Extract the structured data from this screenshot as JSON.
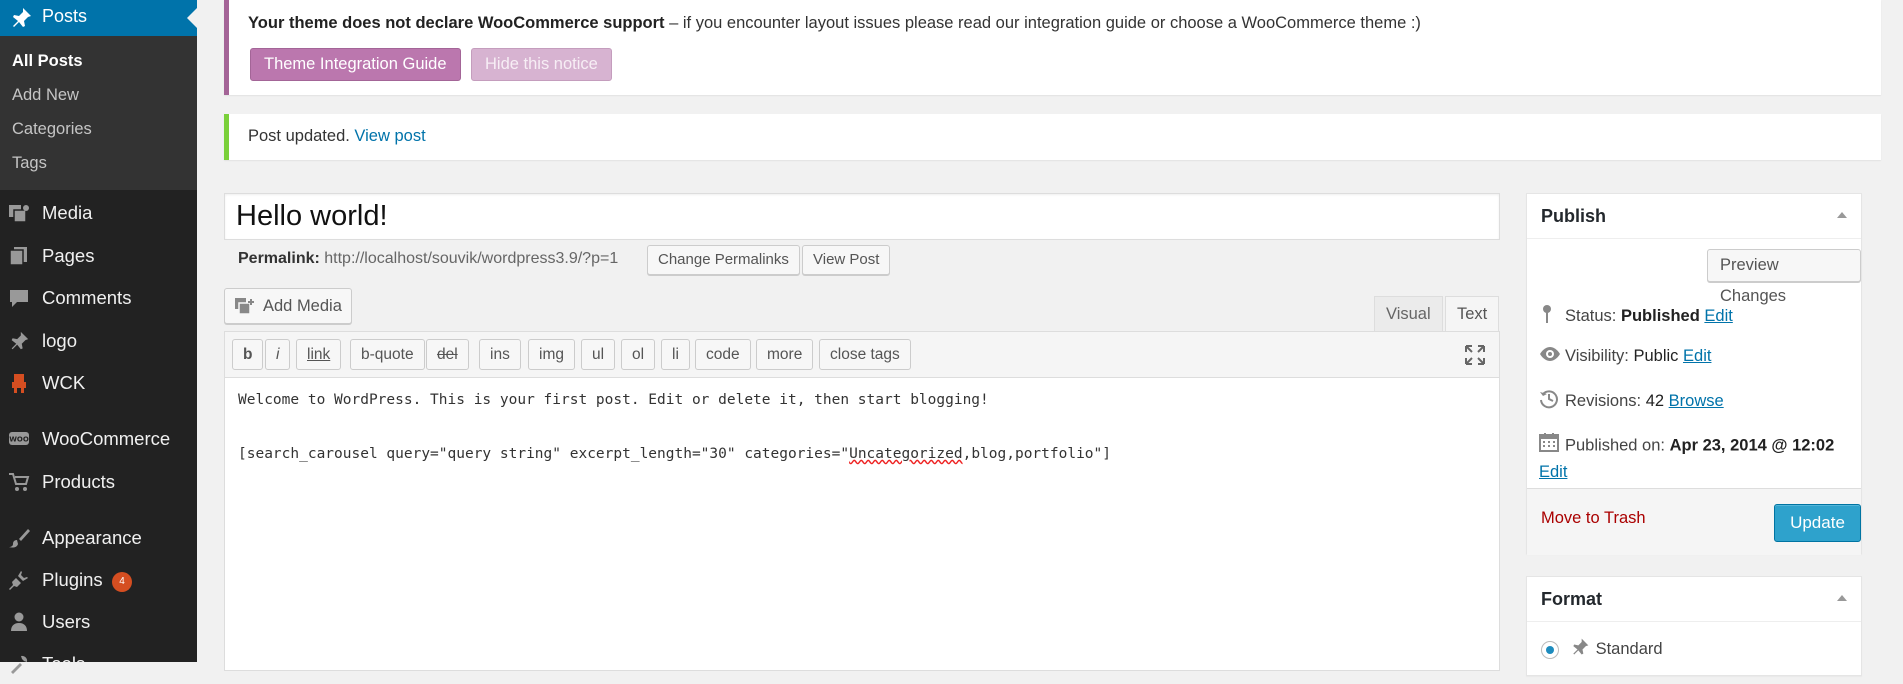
{
  "sidebar": {
    "posts_label": "Posts",
    "submenu": [
      "All Posts",
      "Add New",
      "Categories",
      "Tags"
    ],
    "menu": [
      {
        "label": "Media",
        "icon": "media-icon"
      },
      {
        "label": "Pages",
        "icon": "pages-icon"
      },
      {
        "label": "Comments",
        "icon": "comments-icon"
      },
      {
        "label": "logo",
        "icon": "pin-icon"
      },
      {
        "label": "WCK",
        "icon": "wck-icon"
      },
      {
        "label": "WooCommerce",
        "icon": "woocommerce-icon"
      },
      {
        "label": "Products",
        "icon": "cart-icon"
      },
      {
        "label": "Appearance",
        "icon": "paintbrush-icon"
      },
      {
        "label": "Plugins",
        "icon": "plugin-icon",
        "badge": "4"
      },
      {
        "label": "Users",
        "icon": "users-icon"
      },
      {
        "label": "Tools",
        "icon": "tools-icon"
      }
    ]
  },
  "notices": {
    "woo": {
      "bold": "Your theme does not declare WooCommerce support",
      "rest": " – if you encounter layout issues please read our integration guide or choose a WooCommerce theme :)",
      "guide_button": "Theme Integration Guide",
      "hide_button": "Hide this notice"
    },
    "updated": {
      "text": "Post updated. ",
      "link": "View post"
    }
  },
  "editor": {
    "title": "Hello world!",
    "permalink_label": "Permalink:",
    "permalink_url": "http://localhost/souvik/wordpress3.9/?p=1",
    "change_permalinks": "Change Permalinks",
    "view_post": "View Post",
    "add_media": "Add Media",
    "tabs": [
      "Visual",
      "Text"
    ],
    "quicktags": [
      "b",
      "i",
      "link",
      "b-quote",
      "del",
      "ins",
      "img",
      "ul",
      "ol",
      "li",
      "code",
      "more",
      "close tags"
    ],
    "content_line1": "Welcome to WordPress. This is your first post. Edit or delete it, then start blogging!",
    "content_line3_a": "[search_carousel query=\"query string\" excerpt_length=\"30\" categories=\"",
    "content_line3_b": "Uncategorized",
    "content_line3_c": ",blog,portfolio\"]"
  },
  "publish": {
    "heading": "Publish",
    "preview_button": "Preview Changes",
    "status_label": "Status: ",
    "status_value": "Published",
    "visibility_label": "Visibility: ",
    "visibility_value": "Public",
    "revisions_label": "Revisions: ",
    "revisions_value": "42",
    "browse": "Browse",
    "published_label": "Published on: ",
    "published_value": "Apr 23, 2014 @ 12:02",
    "edit": "Edit",
    "trash": "Move to Trash",
    "update": "Update"
  },
  "format": {
    "heading": "Format",
    "selected": "Standard"
  },
  "colors": {
    "accent": "#0073aa",
    "sidebar": "#222222",
    "woo": "#bb77ae",
    "success": "#7ad03a",
    "update": "#2ea2cc"
  }
}
